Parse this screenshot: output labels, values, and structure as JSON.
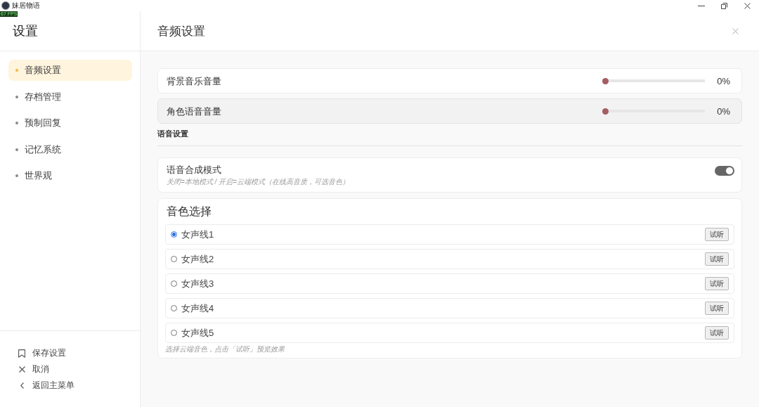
{
  "window": {
    "title": "妹居物语",
    "fps": "67 FPS"
  },
  "sidebar": {
    "title": "设置",
    "items": [
      {
        "label": "音频设置",
        "selected": true
      },
      {
        "label": "存档管理",
        "selected": false
      },
      {
        "label": "预制回复",
        "selected": false
      },
      {
        "label": "记忆系统",
        "selected": false
      },
      {
        "label": "世界观",
        "selected": false
      }
    ],
    "actions": [
      {
        "kind": "save",
        "label": "保存设置"
      },
      {
        "kind": "cancel",
        "label": "取消"
      },
      {
        "kind": "back",
        "label": "返回主菜单"
      }
    ]
  },
  "main": {
    "title": "音频设置",
    "sliders": [
      {
        "label": "背景音乐音量",
        "level": 0,
        "reading": "0%",
        "hovered": false
      },
      {
        "label": "角色语音音量",
        "level": 0,
        "reading": "0%",
        "hovered": true
      }
    ],
    "section": "语音设置",
    "toggle": {
      "label": "语音合成模式",
      "hint": "关闭=本地模式 / 开启=云端模式（在线高音质，可选音色）",
      "on": true
    },
    "voices": {
      "title": "音色选择",
      "options": [
        {
          "label": "女声线1",
          "selected": true,
          "button": "试听"
        },
        {
          "label": "女声线2",
          "selected": false,
          "button": "试听"
        },
        {
          "label": "女声线3",
          "selected": false,
          "button": "试听"
        },
        {
          "label": "女声线4",
          "selected": false,
          "button": "试听"
        },
        {
          "label": "女声线5",
          "selected": false,
          "button": "试听"
        }
      ],
      "hint": "选择云端音色，点击「试听」预览效果"
    }
  }
}
